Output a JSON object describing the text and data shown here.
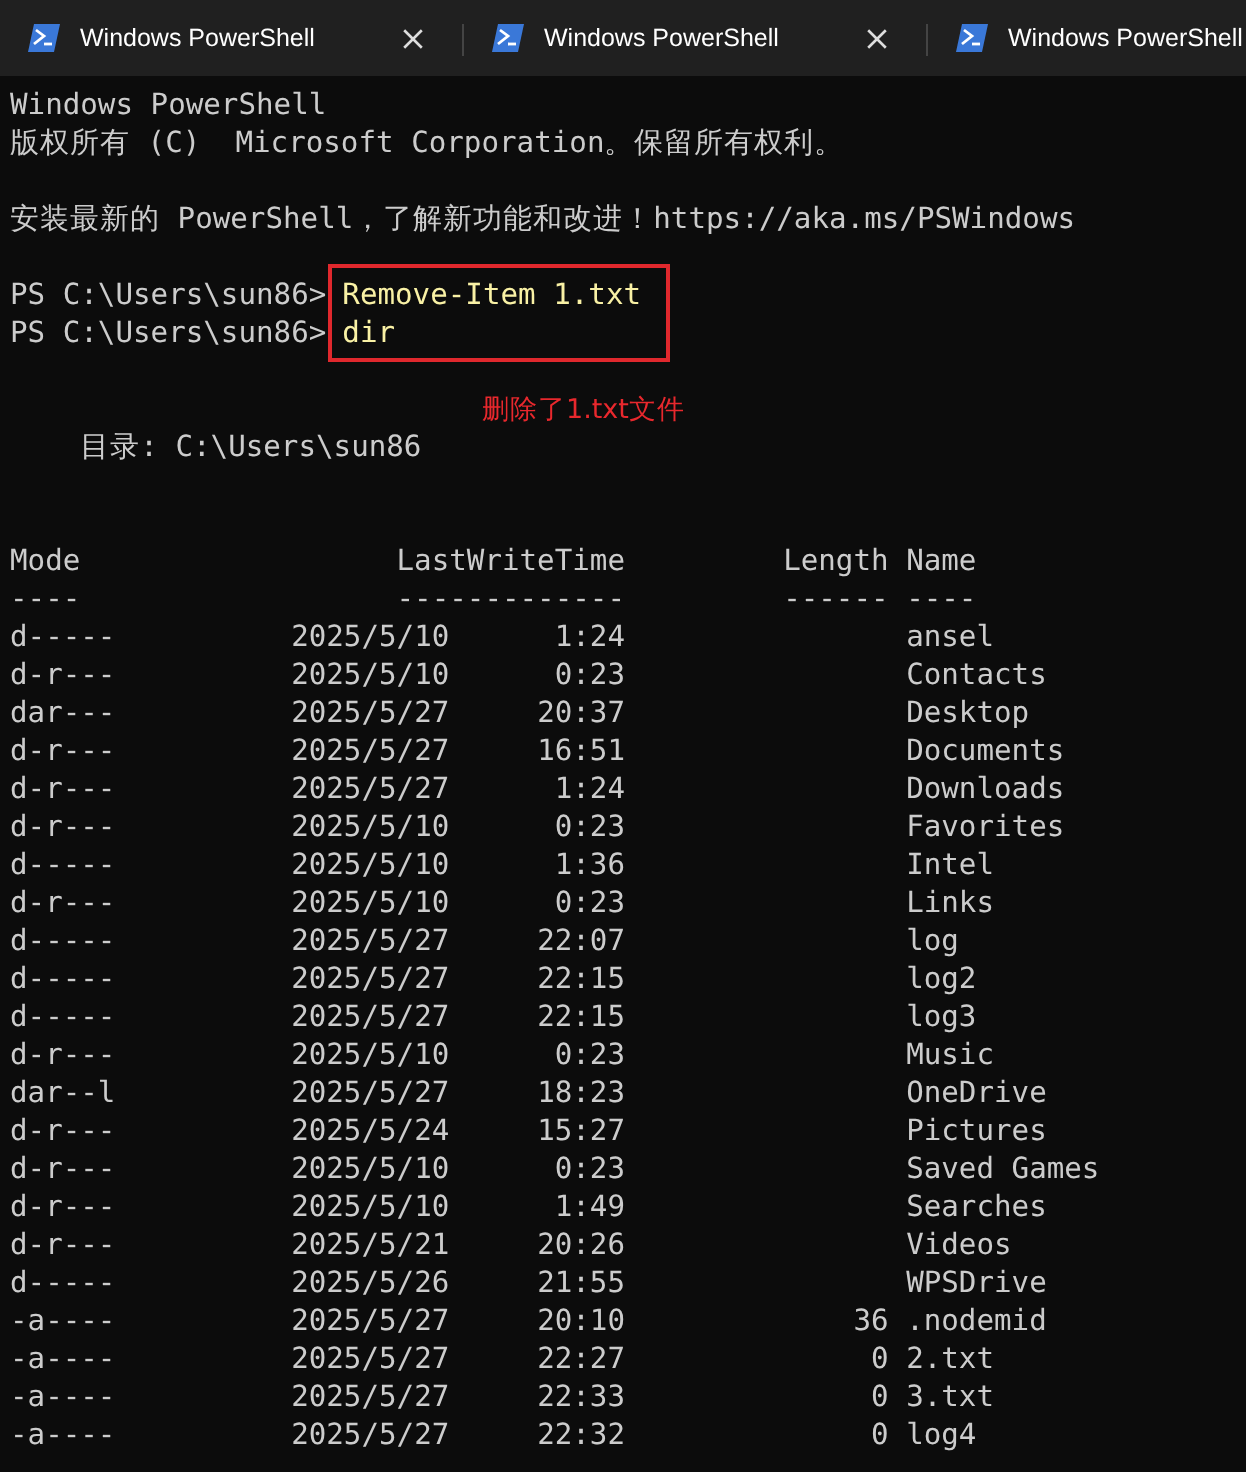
{
  "tabs": [
    {
      "title": "Windows PowerShell"
    },
    {
      "title": "Windows PowerShell"
    },
    {
      "title": "Windows PowerShell"
    }
  ],
  "terminal": {
    "banner": [
      "Windows PowerShell",
      "版权所有 (C)  Microsoft Corporation。保留所有权利。"
    ],
    "notice": "安装最新的 PowerShell，了解新功能和改进！https://aka.ms/PSWindows",
    "commands": [
      {
        "prompt": "PS C:\\Users\\sun86>",
        "command": "Remove-Item 1.txt"
      },
      {
        "prompt": "PS C:\\Users\\sun86>",
        "command": "dir"
      }
    ],
    "annotation": "删除了1.txt文件",
    "directory": "目录: C:\\Users\\sun86",
    "table": {
      "columns": [
        "Mode",
        "LastWriteTime",
        "Length",
        "Name"
      ],
      "rules": [
        "----",
        "-------------",
        "------",
        "----"
      ],
      "rows": [
        {
          "mode": "d-----",
          "date": "2025/5/10",
          "time": "1:24",
          "length": "",
          "name": "ansel"
        },
        {
          "mode": "d-r---",
          "date": "2025/5/10",
          "time": "0:23",
          "length": "",
          "name": "Contacts"
        },
        {
          "mode": "dar---",
          "date": "2025/5/27",
          "time": "20:37",
          "length": "",
          "name": "Desktop"
        },
        {
          "mode": "d-r---",
          "date": "2025/5/27",
          "time": "16:51",
          "length": "",
          "name": "Documents"
        },
        {
          "mode": "d-r---",
          "date": "2025/5/27",
          "time": "1:24",
          "length": "",
          "name": "Downloads"
        },
        {
          "mode": "d-r---",
          "date": "2025/5/10",
          "time": "0:23",
          "length": "",
          "name": "Favorites"
        },
        {
          "mode": "d-----",
          "date": "2025/5/10",
          "time": "1:36",
          "length": "",
          "name": "Intel"
        },
        {
          "mode": "d-r---",
          "date": "2025/5/10",
          "time": "0:23",
          "length": "",
          "name": "Links"
        },
        {
          "mode": "d-----",
          "date": "2025/5/27",
          "time": "22:07",
          "length": "",
          "name": "log"
        },
        {
          "mode": "d-----",
          "date": "2025/5/27",
          "time": "22:15",
          "length": "",
          "name": "log2"
        },
        {
          "mode": "d-----",
          "date": "2025/5/27",
          "time": "22:15",
          "length": "",
          "name": "log3"
        },
        {
          "mode": "d-r---",
          "date": "2025/5/10",
          "time": "0:23",
          "length": "",
          "name": "Music"
        },
        {
          "mode": "dar--l",
          "date": "2025/5/27",
          "time": "18:23",
          "length": "",
          "name": "OneDrive"
        },
        {
          "mode": "d-r---",
          "date": "2025/5/24",
          "time": "15:27",
          "length": "",
          "name": "Pictures"
        },
        {
          "mode": "d-r---",
          "date": "2025/5/10",
          "time": "0:23",
          "length": "",
          "name": "Saved Games"
        },
        {
          "mode": "d-r---",
          "date": "2025/5/10",
          "time": "1:49",
          "length": "",
          "name": "Searches"
        },
        {
          "mode": "d-r---",
          "date": "2025/5/21",
          "time": "20:26",
          "length": "",
          "name": "Videos"
        },
        {
          "mode": "d-----",
          "date": "2025/5/26",
          "time": "21:55",
          "length": "",
          "name": "WPSDrive"
        },
        {
          "mode": "-a----",
          "date": "2025/5/27",
          "time": "20:10",
          "length": "36",
          "name": ".nodemid"
        },
        {
          "mode": "-a----",
          "date": "2025/5/27",
          "time": "22:27",
          "length": "0",
          "name": "2.txt"
        },
        {
          "mode": "-a----",
          "date": "2025/5/27",
          "time": "22:33",
          "length": "0",
          "name": "3.txt"
        },
        {
          "mode": "-a----",
          "date": "2025/5/27",
          "time": "22:32",
          "length": "0",
          "name": "log4"
        }
      ]
    }
  }
}
